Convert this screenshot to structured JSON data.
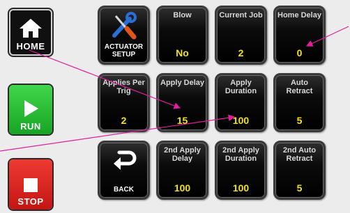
{
  "sidebar": {
    "home_label": "HOME",
    "run_label": "RUN",
    "stop_label": "STOP"
  },
  "tiles": {
    "actuator_setup": {
      "label": "ACTUATOR SETUP"
    },
    "blow": {
      "title": "Blow",
      "value": "No"
    },
    "current_job": {
      "title": "Current Job",
      "value": "2"
    },
    "home_delay": {
      "title": "Home Delay",
      "value": "0"
    },
    "applies_per_trig": {
      "title": "Applies Per Trig",
      "value": "2"
    },
    "apply_delay": {
      "title": "Apply Delay",
      "value": "15"
    },
    "apply_duration": {
      "title": "Apply Duration",
      "value": "100"
    },
    "auto_retract": {
      "title": "Auto Retract",
      "value": "5"
    },
    "back": {
      "label": "BACK"
    },
    "apply2_delay": {
      "title": "2nd Apply Delay",
      "value": "100"
    },
    "apply2_duration": {
      "title": "2nd Apply Duration",
      "value": "100"
    },
    "auto2_retract": {
      "title": "2nd Auto Retract",
      "value": "5"
    }
  },
  "colors": {
    "value": "#f2e21c",
    "run": "#22b22e",
    "stop": "#d21f1b",
    "callout_line": "#e0209a"
  }
}
